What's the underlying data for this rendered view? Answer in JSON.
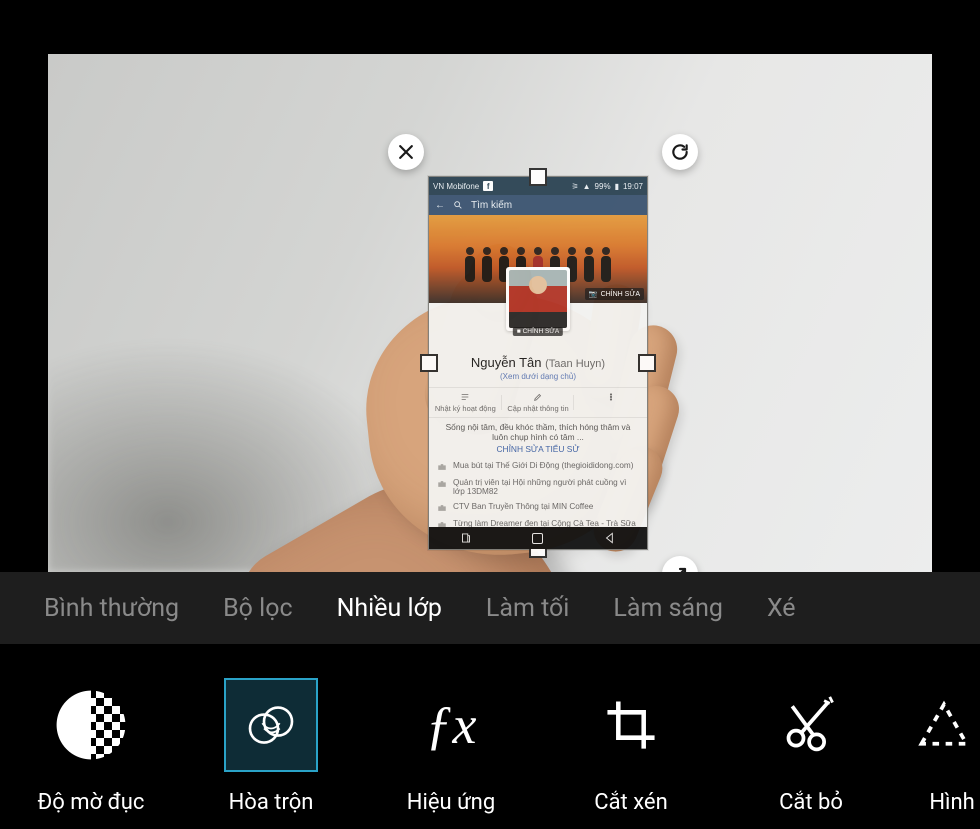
{
  "modes": {
    "normal": "Bình thường",
    "filter": "Bộ lọc",
    "multiply": "Nhiều lớp",
    "darken": "Làm tối",
    "lighten": "Làm sáng",
    "partial": "Xé"
  },
  "tools": {
    "opacity": "Độ mờ đục",
    "blend": "Hòa trộn",
    "fx": "Hiệu ứng",
    "crop": "Cắt xén",
    "cut": "Cắt bỏ",
    "shape": "Hình d"
  },
  "fx_glyph": "ƒx",
  "layer": {
    "statusbar": {
      "carrier": "VN Mobifone",
      "battery_pct": "99%",
      "clock": "19:07"
    },
    "fb_search_placeholder": "Tìm kiếm",
    "cover_edit": "CHỈNH SỬA",
    "avatar_edit": "CHỈNH SỬA",
    "profile_name": "Nguyễn Tân",
    "profile_alt": "(Taan Huyn)",
    "profile_subtitle": "(Xem dưới dạng chủ)",
    "tabs3": {
      "activity": "Nhật ký hoạt động",
      "update": "Cập nhật thông tin"
    },
    "bio_line1": "Sống nội tâm, đều khóc thầm, thích hóng thâm và",
    "bio_line2": "luôn chụp hình có tâm ...",
    "bio_link": "CHỈNH SỬA TIỂU SỬ",
    "info": {
      "r1": "Mua bút tại Thế Giới Di Động (thegioididong.com)",
      "r2": "Quản trị viên tại Hội những người phát cuồng vì lớp 13DM82",
      "r3": "CTV Ban Truyền Thông tại MIN Coffee",
      "r4": "Từng làm Dreamer đen tại Cộng Cà Tea - Trà Sữa Việt"
    }
  }
}
